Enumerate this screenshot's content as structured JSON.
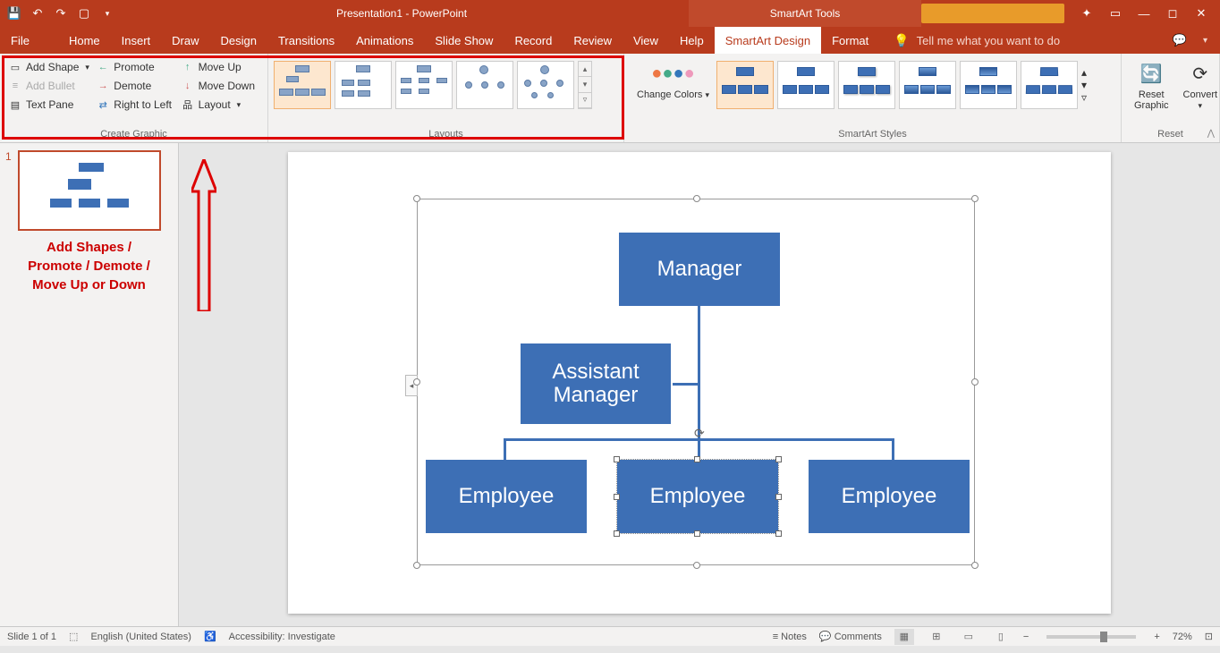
{
  "titlebar": {
    "title": "Presentation1 - PowerPoint",
    "tools_title": "SmartArt Tools"
  },
  "menu": {
    "file": "File",
    "tabs": [
      "Home",
      "Insert",
      "Draw",
      "Design",
      "Transitions",
      "Animations",
      "Slide Show",
      "Record",
      "Review",
      "View",
      "Help",
      "SmartArt Design",
      "Format"
    ],
    "active_tab": "SmartArt Design",
    "tellme": "Tell me what you want to do"
  },
  "ribbon": {
    "create_graphic": {
      "label": "Create Graphic",
      "add_shape": "Add Shape",
      "add_bullet": "Add Bullet",
      "text_pane": "Text Pane",
      "promote": "Promote",
      "demote": "Demote",
      "right_to_left": "Right to Left",
      "move_up": "Move Up",
      "move_down": "Move Down",
      "layout": "Layout"
    },
    "layouts": {
      "label": "Layouts"
    },
    "change_colors": "Change Colors",
    "smartart_styles": {
      "label": "SmartArt Styles"
    },
    "reset": {
      "label": "Reset",
      "reset_graphic": "Reset Graphic",
      "convert": "Convert"
    }
  },
  "annotation": {
    "line1": "Add Shapes /",
    "line2": "Promote / Demote /",
    "line3": "Move Up or Down"
  },
  "slide_panel": {
    "num": "1"
  },
  "org": {
    "manager": "Manager",
    "assistant": "Assistant Manager",
    "employee1": "Employee",
    "employee2": "Employee",
    "employee3": "Employee"
  },
  "statusbar": {
    "slide": "Slide 1 of 1",
    "lang": "English (United States)",
    "accessibility": "Accessibility: Investigate",
    "notes": "Notes",
    "comments": "Comments",
    "zoom": "72%"
  }
}
